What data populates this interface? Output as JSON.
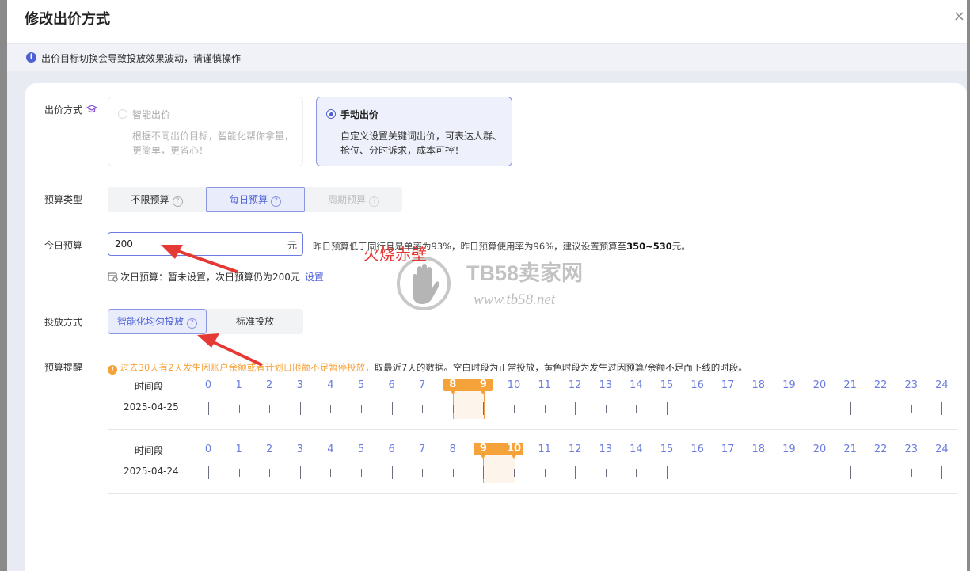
{
  "modal": {
    "title": "修改出价方式"
  },
  "notice": {
    "text": "出价目标切换会导致投放效果波动，请谨慎操作"
  },
  "bid_method": {
    "label": "出价方式",
    "smart": {
      "title": "智能出价",
      "desc1": "根据不同出价目标，智能化帮你拿量，",
      "desc2": "更简单，更省心！",
      "enabled": false
    },
    "manual": {
      "title": "手动出价",
      "desc1": "自定义设置关键词出价，可表达人群、",
      "desc2": "抢位、分时诉求，成本可控！",
      "selected": true
    }
  },
  "budget_type": {
    "label": "预算类型",
    "options": [
      "不限预算",
      "每日预算",
      "周期预算"
    ],
    "selected": "每日预算"
  },
  "today_budget": {
    "label": "今日预算",
    "value": "200",
    "unit": "元",
    "hint_pre": "昨日预算低于同行且是单率为93%，昨日预算使用率为96%，建议设置预算至",
    "hint_range": "350~530",
    "hint_post": "元。",
    "next_pre": "次日预算：",
    "next_text": "暂未设置，次日预算仍为200元",
    "next_link": "设置"
  },
  "delivery": {
    "label": "投放方式",
    "options": [
      "智能化均匀投放",
      "标准投放"
    ],
    "selected": "智能化均匀投放"
  },
  "reminder": {
    "label": "预算提醒",
    "warn": "过去30天有2天发生因账户余额或者计划日限额不足暂停投放，",
    "info": "取最近7天的数据。空白时段为正常投放，黄色时段为发生过因预算/余额不足而下线的时段。",
    "row_label": "时间段",
    "hours": [
      "0",
      "1",
      "2",
      "3",
      "4",
      "5",
      "6",
      "7",
      "8",
      "9",
      "10",
      "11",
      "12",
      "13",
      "14",
      "15",
      "16",
      "17",
      "18",
      "19",
      "20",
      "21",
      "22",
      "23",
      "24"
    ],
    "rows": [
      {
        "date": "2025-04-25",
        "offline_start": 8,
        "offline_end": 9
      },
      {
        "date": "2025-04-24",
        "offline_start": 9,
        "offline_end": 10
      }
    ]
  },
  "watermark": {
    "brand": "TB58卖家网",
    "url": "www.tb58.net",
    "red_text": "火烧赤壁"
  },
  "colors": {
    "accent": "#4c5fd6",
    "warning": "#f5a23b",
    "arrow": "#e53935"
  }
}
